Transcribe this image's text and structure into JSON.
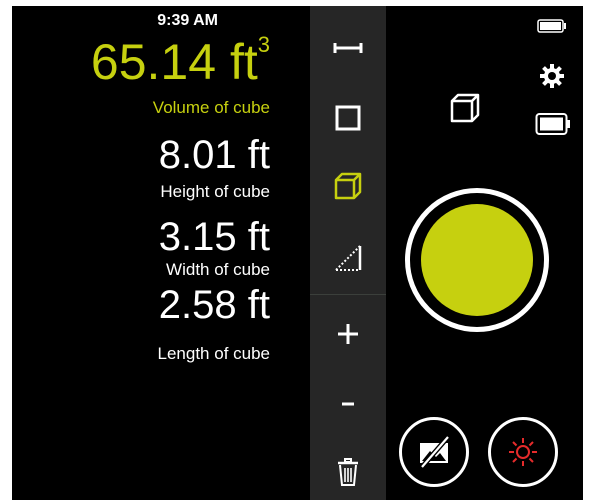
{
  "status": {
    "time": "9:39 AM"
  },
  "volume": {
    "value": "65.14",
    "unit": "ft",
    "exponent": "3",
    "label": "Volume of cube"
  },
  "measurements": [
    {
      "value": "8.01 ft",
      "label": "Height of cube"
    },
    {
      "value": "3.15 ft",
      "label": "Width of cube"
    },
    {
      "value": "2.58 ft",
      "label": "Length of cube"
    }
  ],
  "toolbar": {
    "tools": [
      "ruler-icon",
      "square-icon",
      "cube-icon",
      "triangle-icon"
    ],
    "selected_tool": "cube-icon",
    "actions": [
      "plus-icon",
      "minus-icon",
      "trash-icon"
    ]
  },
  "colors": {
    "accent": "#c6d00f",
    "background": "#000000",
    "toolbar": "#262626",
    "flash": "#e52b2b"
  },
  "camera": {
    "mode_icon": "cube-icon",
    "settings_icon": "gear-icon",
    "battery_icon": "battery-icon",
    "shutter": "shutter-button",
    "gallery_disabled_icon": "photo-off-icon",
    "flash_icon": "flash-sun-icon"
  }
}
